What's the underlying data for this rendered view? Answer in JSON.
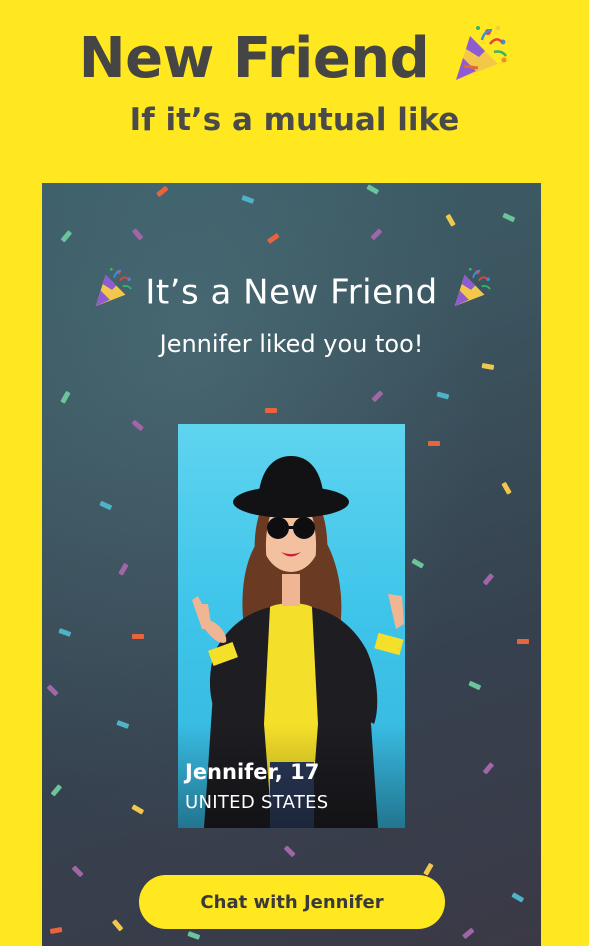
{
  "promo": {
    "title": "New Friend",
    "title_emoji": "party-popper-icon",
    "subtitle": "If it’s a mutual like"
  },
  "match_screen": {
    "title": "It’s a New Friend",
    "subtitle": "Jennifer liked you too!",
    "profile": {
      "name_age": "Jennifer, 17",
      "country": "UNITED STATES"
    },
    "chat_button_label": "Chat with Jennifer"
  },
  "colors": {
    "background_yellow": "#FFE81F",
    "title_gray": "#454545",
    "screen_teal": "#3a5b66",
    "screen_dark": "#36414f",
    "photo_blue": "#3fc5ea",
    "button_yellow": "#FFE81F",
    "confetti": [
      "#e8643c",
      "#4fb3c8",
      "#6cc49a",
      "#a066a8",
      "#f0c850"
    ]
  }
}
